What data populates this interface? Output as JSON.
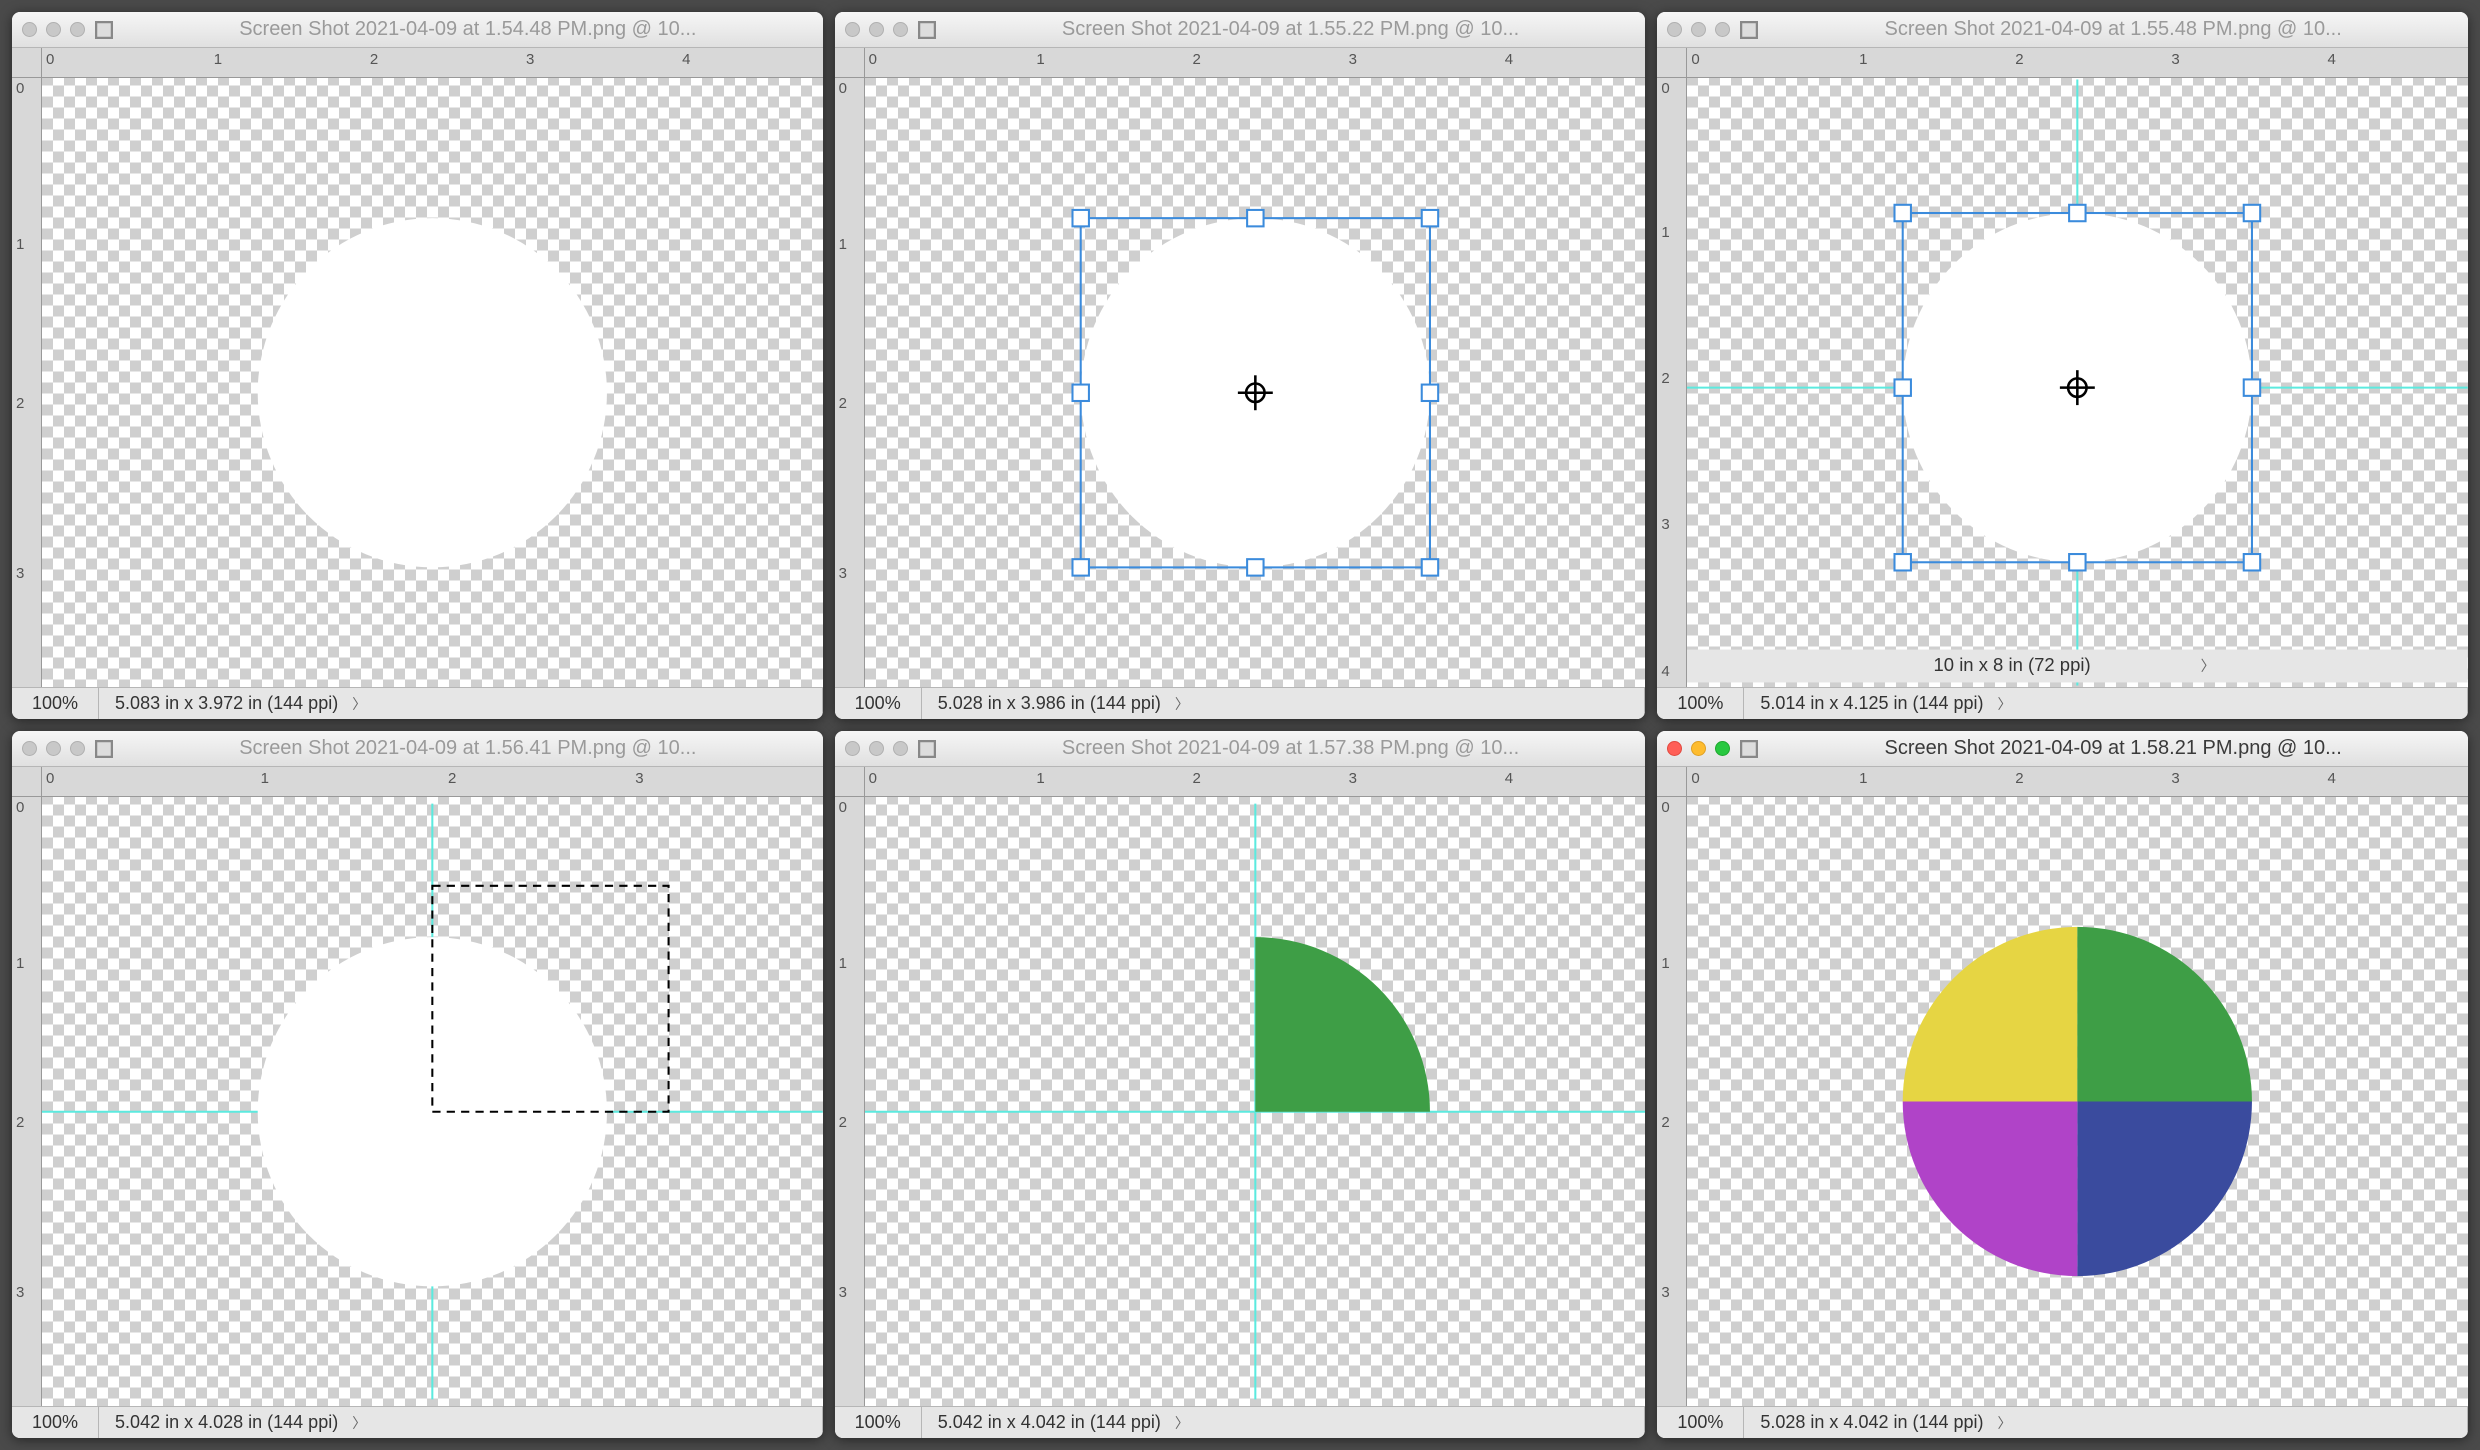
{
  "windows": [
    {
      "active": false,
      "title": "Screen Shot 2021-04-09 at 1.54.48 PM.png @ 10...",
      "zoom": "100%",
      "info": "5.083 in x 3.972 in (144 ppi)",
      "ruler_h": [
        "0",
        "1",
        "2",
        "3",
        "4"
      ],
      "ruler_v": [
        "0",
        "1",
        "2",
        "3"
      ]
    },
    {
      "active": false,
      "title": "Screen Shot 2021-04-09 at 1.55.22 PM.png @ 10...",
      "zoom": "100%",
      "info": "5.028 in x 3.986 in (144 ppi)",
      "ruler_h": [
        "0",
        "1",
        "2",
        "3",
        "4"
      ],
      "ruler_v": [
        "0",
        "1",
        "2",
        "3"
      ]
    },
    {
      "active": false,
      "title": "Screen Shot 2021-04-09 at 1.55.48 PM.png @ 10...",
      "zoom": "100%",
      "info_top": "10 in x 8 in (72 ppi)",
      "info": "5.014 in x 4.125 in (144 ppi)",
      "ruler_h": [
        "0",
        "1",
        "2",
        "3",
        "4"
      ],
      "ruler_v": [
        "0",
        "1",
        "2",
        "3",
        "4"
      ]
    },
    {
      "active": false,
      "title": "Screen Shot 2021-04-09 at 1.56.41 PM.png @ 10...",
      "zoom": "100%",
      "info": "5.042 in x 4.028 in (144 ppi)",
      "ruler_h": [
        "0",
        "1",
        "2",
        "3"
      ],
      "ruler_v": [
        "0",
        "1",
        "2",
        "3"
      ]
    },
    {
      "active": false,
      "title": "Screen Shot 2021-04-09 at 1.57.38 PM.png @ 10...",
      "zoom": "100%",
      "info": "5.042 in x 4.042 in (144 ppi)",
      "ruler_h": [
        "0",
        "1",
        "2",
        "3",
        "4"
      ],
      "ruler_v": [
        "0",
        "1",
        "2",
        "3"
      ]
    },
    {
      "active": true,
      "title": "Screen Shot 2021-04-09 at 1.58.21 PM.png @ 10...",
      "zoom": "100%",
      "info": "5.028 in x 4.042 in (144 ppi)",
      "ruler_h": [
        "0",
        "1",
        "2",
        "3",
        "4"
      ],
      "ruler_v": [
        "0",
        "1",
        "2",
        "3"
      ]
    }
  ],
  "colors": {
    "green": "#3e9e46",
    "yellow": "#e6d543",
    "purple": "#b043c8",
    "blue": "#3a4b9e",
    "guide": "#5ceadf",
    "handle": "#3b8bdc"
  },
  "chart_data": {
    "type": "pie",
    "title": "",
    "series": [
      {
        "name": "Yellow",
        "value": 25,
        "color": "#e6d543"
      },
      {
        "name": "Green",
        "value": 25,
        "color": "#3e9e46"
      },
      {
        "name": "Blue",
        "value": 25,
        "color": "#3a4b9e"
      },
      {
        "name": "Purple",
        "value": 25,
        "color": "#b043c8"
      }
    ]
  }
}
